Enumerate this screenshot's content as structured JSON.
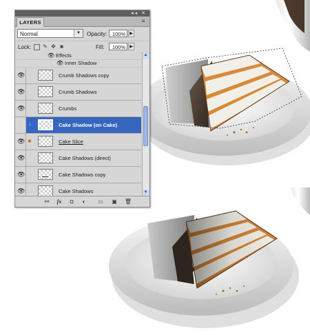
{
  "panel": {
    "tab_label": "LAYERS",
    "title_controls": "◂◂ ✕",
    "menu_glyph": "≡",
    "blend_mode": "Normal",
    "opacity_label": "Opacity:",
    "opacity_value": "100%",
    "lock_label": "Lock:",
    "fill_label": "Fill:",
    "fill_value": "100%"
  },
  "effects": {
    "group_label": "Effects",
    "inner_shadow_label": "Inner Shadow"
  },
  "layers": [
    {
      "name": "Crumb Shadows copy",
      "visible": true,
      "selected": false
    },
    {
      "name": "Crumb Shadows",
      "visible": true,
      "selected": false
    },
    {
      "name": "Crumbs",
      "visible": true,
      "selected": false
    },
    {
      "name": "Cake Shadow (on Cake)",
      "visible": false,
      "selected": true
    },
    {
      "name": "Cake Slice",
      "visible": true,
      "selected": false
    },
    {
      "name": "Cake Shadows (direct)",
      "visible": true,
      "selected": false
    },
    {
      "name": "Cake Shadows copy",
      "visible": true,
      "selected": false
    },
    {
      "name": "Cake Shadows",
      "visible": true,
      "selected": false
    }
  ],
  "icons": {
    "eye": "eye-icon",
    "link": "link-icon",
    "fx": "fx-icon",
    "mask": "add-mask-icon",
    "adjustment": "adjustment-layer-icon",
    "group": "new-group-icon",
    "new_layer": "new-layer-icon",
    "trash": "trash-icon"
  },
  "footer": {
    "link_glyph": "⚯",
    "fx_glyph": "fx",
    "mask_glyph": "◘",
    "adjust_glyph": "◐",
    "group_glyph": "▭",
    "new_glyph": "▣",
    "trash_glyph": "🗑"
  },
  "colors": {
    "selection": "#3666c0",
    "panel_bg": "#d6d6d6",
    "titlebar": "#5e5e5e"
  }
}
